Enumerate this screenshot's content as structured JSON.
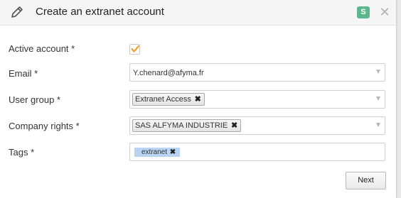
{
  "dialog": {
    "title": "Create an extranet account",
    "badge": "S",
    "close_glyph": "✕",
    "icons": {
      "edit": "pencil-icon",
      "close": "close-icon",
      "checkbox": "checkmark-icon",
      "remove": "remove-x-icon",
      "dropdown": "chevron-down-icon"
    }
  },
  "form": {
    "active_account": {
      "label": "Active account *",
      "checked": true
    },
    "email": {
      "label": "Email *",
      "value": "Y.chenard@afyma.fr"
    },
    "user_group": {
      "label": "User group *",
      "selected": [
        "Extranet Access"
      ]
    },
    "company_rights": {
      "label": "Company rights *",
      "selected": [
        "SAS ALFYMA INDUSTRIE"
      ]
    },
    "tags": {
      "label": "Tags *",
      "selected": [
        "extranet"
      ]
    },
    "remove_glyph": "✖"
  },
  "actions": {
    "next_label": "Next"
  },
  "colors": {
    "badge_bg": "#5cb88a",
    "checkmark": "#f0a030",
    "tag_bg": "#b8d4f2",
    "header_bg": "#f5f5f5"
  }
}
